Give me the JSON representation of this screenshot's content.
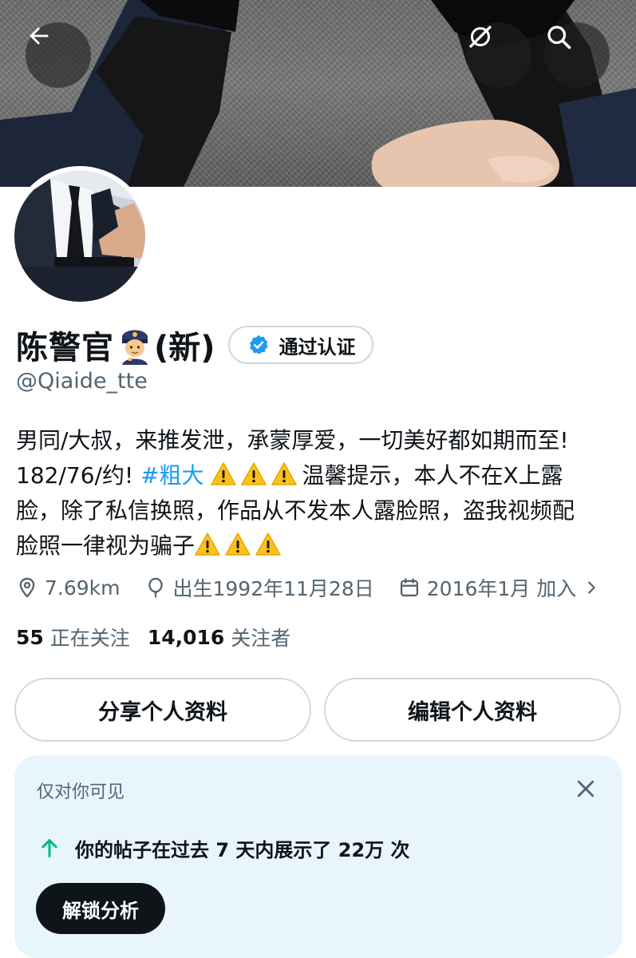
{
  "profile": {
    "display_name": "陈警官",
    "name_suffix": "(新)",
    "verified_label": "通过认证",
    "handle": "@Qiaide_tte"
  },
  "bio": {
    "line1": "男同/大叔，来推发泄，承蒙厚爱，一切美好都如期而至!",
    "line2_prefix": "182/76/约! ",
    "hashtag": "#粗大",
    "line2_suffix": "温馨提示，本人不在X上露",
    "line3": "脸，除了私信换照，作品从不发本人露脸照，盗我视频配",
    "line4": "脸照一律视为骗子"
  },
  "meta": {
    "location": "7.69km",
    "birthday": "出生1992年11月28日",
    "joined": "2016年1月 加入"
  },
  "counts": {
    "following_num": "55",
    "following_label": "正在关注",
    "followers_num": "14,016",
    "followers_label": "关注者"
  },
  "actions": {
    "share_label": "分享个人资料",
    "edit_label": "编辑个人资料"
  },
  "analytics_card": {
    "title": "仅对你可见",
    "stat_text": "你的帖子在过去 7 天内展示了 22万 次",
    "unlock_label": "解锁分析"
  },
  "icons": {
    "back": "arrow-left-icon",
    "grok": "grok-icon",
    "search": "search-icon",
    "verified": "verified-badge-icon",
    "location": "location-pin-icon",
    "birthday": "balloon-icon",
    "calendar": "calendar-icon",
    "chevron": "chevron-right-icon",
    "close": "close-icon",
    "stat_arrow": "arrow-up-icon",
    "warning": "warning-icon"
  },
  "colors": {
    "accent_blue": "#1d9bf0",
    "secondary_text": "#536471",
    "card_bg": "#e8f5fd",
    "stat_arrow_green": "#00ba7c",
    "dark_button": "#0f1419"
  }
}
